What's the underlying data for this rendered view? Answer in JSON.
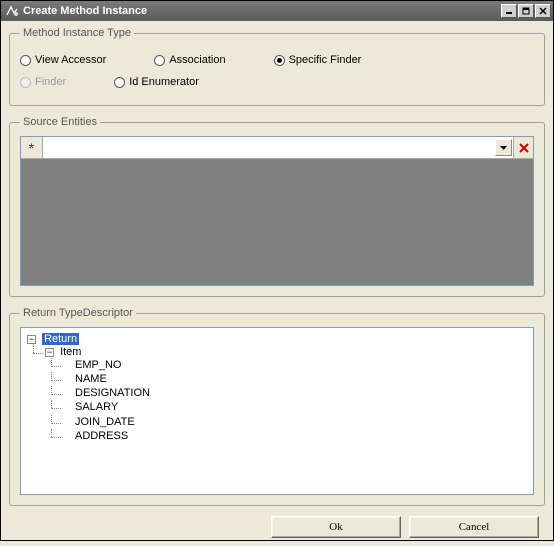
{
  "window": {
    "title": "Create Method Instance"
  },
  "groups": {
    "type_legend": "Method Instance Type",
    "source_legend": "Source Entities",
    "return_legend": "Return TypeDescriptor"
  },
  "radios": {
    "view_accessor": "View Accessor",
    "association": "Association",
    "specific_finder": "Specific Finder",
    "finder": "Finder",
    "id_enumerator": "Id Enumerator",
    "selected": "specific_finder",
    "disabled": [
      "finder"
    ]
  },
  "source": {
    "row_marker": "*"
  },
  "tree": {
    "root": "Return",
    "item": "Item",
    "fields": [
      "EMP_NO",
      "NAME",
      "DESIGNATION",
      "SALARY",
      "JOIN_DATE",
      "ADDRESS"
    ]
  },
  "buttons": {
    "ok": "Ok",
    "cancel": "Cancel"
  }
}
